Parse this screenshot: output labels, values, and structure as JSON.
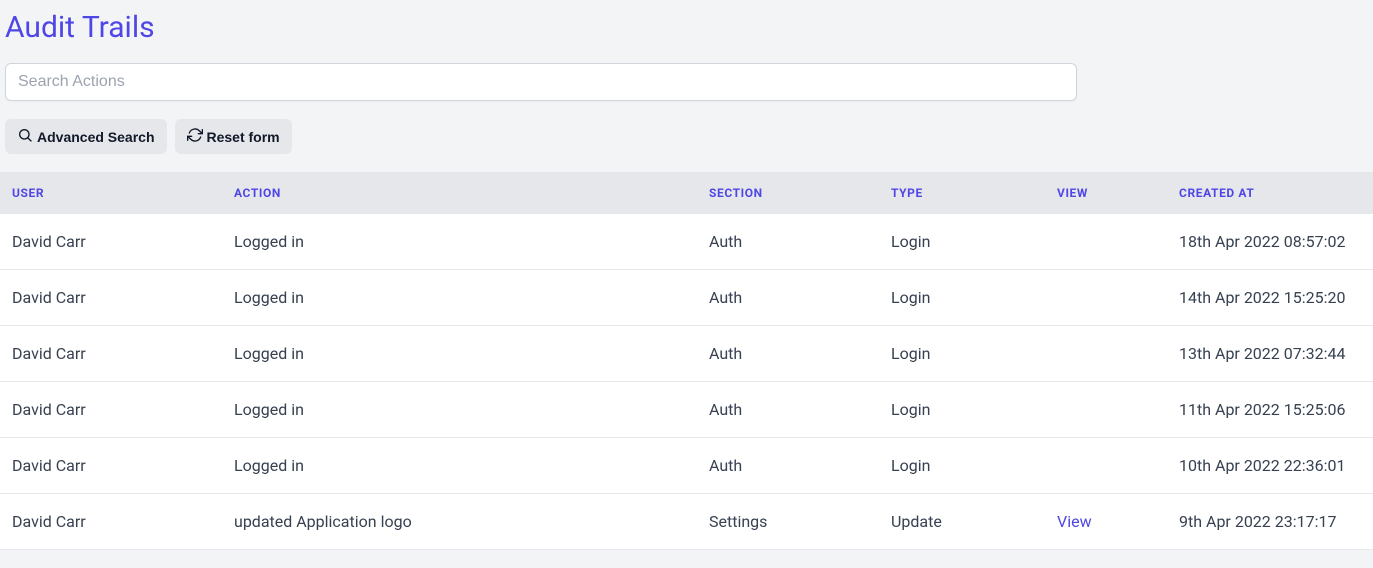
{
  "page_title": "Audit Trails",
  "search": {
    "placeholder": "Search Actions",
    "value": ""
  },
  "buttons": {
    "advanced_search": "Advanced Search",
    "reset_form": "Reset form"
  },
  "table": {
    "headers": {
      "user": "User",
      "action": "Action",
      "section": "Section",
      "type": "Type",
      "view": "View",
      "created_at": "Created At"
    },
    "rows": [
      {
        "user": "David Carr",
        "action": "Logged in",
        "section": "Auth",
        "type": "Login",
        "view": "",
        "created_at": "18th Apr 2022 08:57:02"
      },
      {
        "user": "David Carr",
        "action": "Logged in",
        "section": "Auth",
        "type": "Login",
        "view": "",
        "created_at": "14th Apr 2022 15:25:20"
      },
      {
        "user": "David Carr",
        "action": "Logged in",
        "section": "Auth",
        "type": "Login",
        "view": "",
        "created_at": "13th Apr 2022 07:32:44"
      },
      {
        "user": "David Carr",
        "action": "Logged in",
        "section": "Auth",
        "type": "Login",
        "view": "",
        "created_at": "11th Apr 2022 15:25:06"
      },
      {
        "user": "David Carr",
        "action": "Logged in",
        "section": "Auth",
        "type": "Login",
        "view": "",
        "created_at": "10th Apr 2022 22:36:01"
      },
      {
        "user": "David Carr",
        "action": "updated Application logo",
        "section": "Settings",
        "type": "Update",
        "view": "View",
        "created_at": "9th Apr 2022 23:17:17"
      }
    ]
  }
}
